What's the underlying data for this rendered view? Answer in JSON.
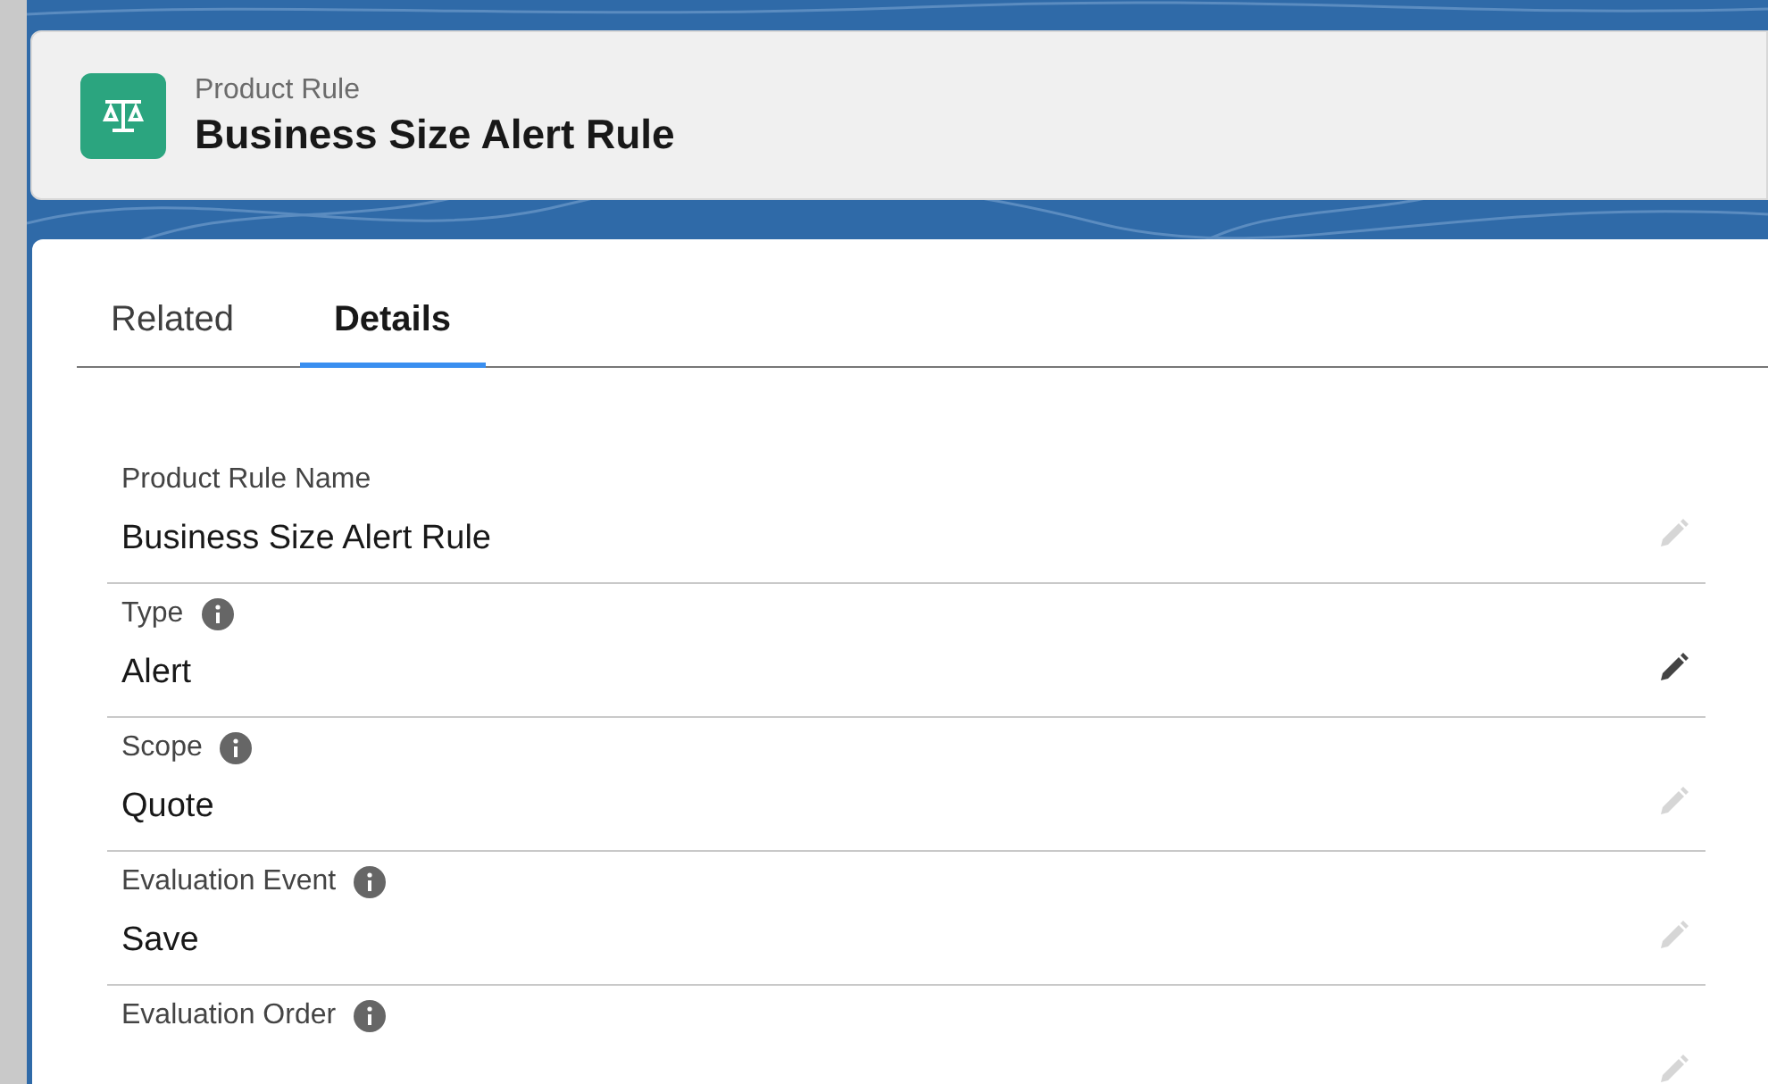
{
  "header": {
    "object_type": "Product Rule",
    "title": "Business Size Alert Rule"
  },
  "tabs": [
    {
      "label": "Related",
      "selected": false
    },
    {
      "label": "Details",
      "selected": true
    }
  ],
  "fields": [
    {
      "label": "Product Rule Name",
      "info": false,
      "value": "Business Size Alert Rule",
      "edit_active": false
    },
    {
      "label": "Type",
      "info": true,
      "value": "Alert",
      "edit_active": true
    },
    {
      "label": "Scope",
      "info": true,
      "value": "Quote",
      "edit_active": false
    },
    {
      "label": "Evaluation Event",
      "info": true,
      "value": "Save",
      "edit_active": false
    },
    {
      "label": "Evaluation Order",
      "info": true,
      "edit_active": false
    }
  ]
}
